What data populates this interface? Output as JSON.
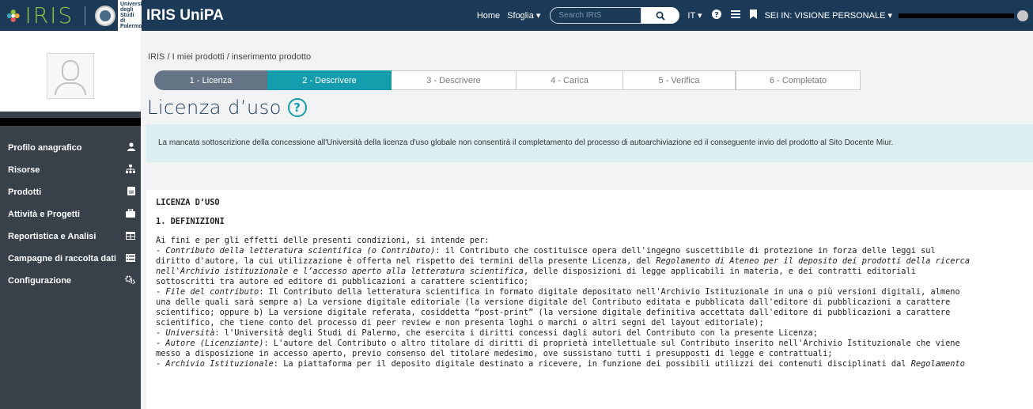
{
  "brand": {
    "logo_text": "IRIS",
    "university_label": "Università degli Studi di Palermo",
    "app_title": "IRIS UniPA"
  },
  "nav": {
    "home": "Home",
    "browse": "Sfoglia",
    "search_placeholder": "Search IRIS",
    "language": "IT",
    "context_label": "SEI IN: VISIONE PERSONALE"
  },
  "sidebar": {
    "items": [
      {
        "label": "Profilo anagrafico",
        "icon": "user-icon"
      },
      {
        "label": "Risorse",
        "icon": "sitemap-icon"
      },
      {
        "label": "Prodotti",
        "icon": "document-icon"
      },
      {
        "label": "Attività e Progetti",
        "icon": "briefcase-icon"
      },
      {
        "label": "Reportistica e Analisi",
        "icon": "table-icon"
      },
      {
        "label": "Campagne di raccolta dati",
        "icon": "list-icon"
      },
      {
        "label": "Configurazione",
        "icon": "gears-icon"
      }
    ]
  },
  "breadcrumb": [
    "IRIS",
    "I miei prodotti",
    "inserimento prodotto"
  ],
  "steps": [
    {
      "label": "1 - Licenza",
      "state": "done"
    },
    {
      "label": "2 - Descrivere",
      "state": "active"
    },
    {
      "label": "3 - Descrivere",
      "state": "todo"
    },
    {
      "label": "4 - Carica",
      "state": "todo"
    },
    {
      "label": "5 - Verifica",
      "state": "todo"
    },
    {
      "label": "6 - Completato",
      "state": "todo"
    }
  ],
  "page_title": "Licenza d’uso",
  "alert_text": "La mancata sottoscrizione della concessione all'Università della licenza d'uso globale non consentirà il completamento del processo di autoarchiviazione ed il conseguente invio del prodotto al Sito Docente Miur.",
  "license": {
    "heading": "LICENZA D’USO",
    "section": "1. DEFINIZIONI",
    "intro": "Ai fini e per gli effetti delle presenti condizioni, si intende per:",
    "contrib_term": "Contributo della letteratura scientifica (o Contributo)",
    "contrib_text1": ": il Contributo che costituisce opera dell'ingegno suscettibile di protezione in forza delle leggi sul",
    "contrib_text2": "diritto d'autore, la cui utilizzazione è offerta nel rispetto dei termini della presente Licenza, del ",
    "contrib_reg": "Regolamento di Ateneo per il deposito dei prodotti della ricerca",
    "contrib_reg2": "nell'Archivio istituzionale e l’accesso aperto alla letteratura scientifica",
    "contrib_text3": ", delle disposizioni di legge applicabili in materia, e dei contratti editoriali",
    "contrib_text4": "sottoscritti tra autore ed editore di pubblicazioni a carattere scientifico;",
    "file_term": "File del contributo",
    "file_text1": ": Il Contributo della letteratura scientifica in formato digitale depositato nell'Archivio Istituzionale in una o più versioni digitali, almeno",
    "file_text2": "una delle quali sarà sempre a) La versione digitale editoriale (la versione digitale del Contributo editata e pubblicata dall'editore di pubblicazioni a carattere",
    "file_text3": "scientifico; oppure b) La versione digitale referata, cosiddetta “post-print” (la versione digitale definitiva accettata dall'editore di pubblicazioni a carattere",
    "file_text4": "scientifico, che tiene conto del processo di peer review e non presenta loghi o marchi o altri segni del layout editoriale);",
    "univ_term": "Università",
    "univ_text": ": l'Università degli Studi di Palermo, che esercita i diritti concessi dagli autori del Contributo con la presente Licenza;",
    "author_term": "Autore (Licenziante)",
    "author_text1": ": L'autore del Contributo o altro titolare di diritti di proprietà intellettuale sul Contributo inserito nell'Archivio Istituzionale che viene",
    "author_text2": "messo a disposizione in accesso aperto, previo consenso del titolare medesimo, ove sussistano tutti i presupposti di legge e contrattuali;",
    "archive_term": "Archivio Istituzionale",
    "archive_text": ": La piattaforma per il deposito digitale destinato a ricevere, in funzione dei possibili utilizzi dei contenuti disciplinati dal ",
    "archive_reg": "Regolamento"
  }
}
